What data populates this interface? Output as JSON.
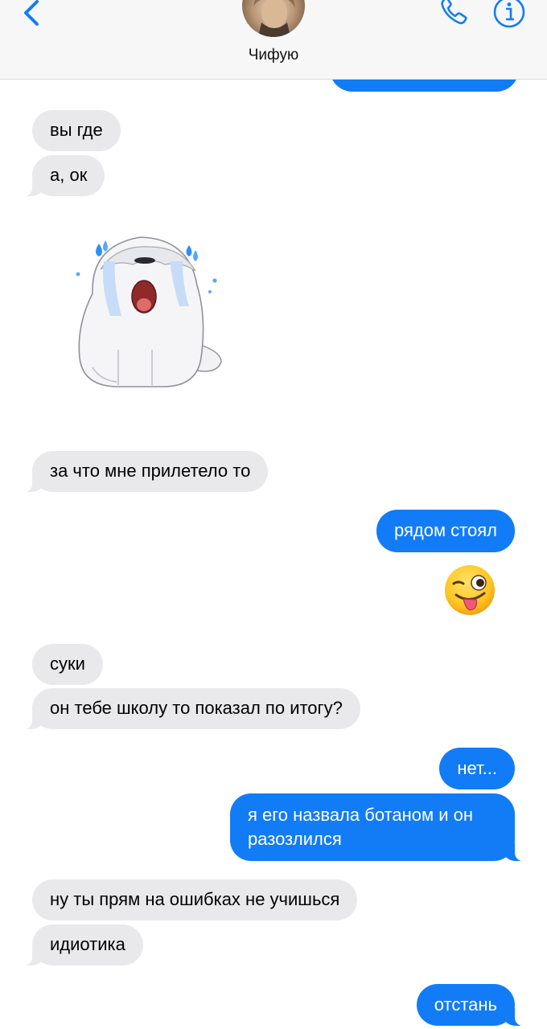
{
  "header": {
    "contact_name": "Чифую",
    "back_icon": "chevron-left-icon",
    "call_icon": "phone-icon",
    "info_icon": "info-icon",
    "accent_color": "#127cf7"
  },
  "messages": [
    {
      "direction": "incoming",
      "text": "вы где"
    },
    {
      "direction": "incoming",
      "text": "а, ок"
    },
    {
      "direction": "incoming",
      "type": "sticker",
      "sticker": "crying-white-dog-sticker"
    },
    {
      "direction": "incoming",
      "text": "за что мне прилетело то"
    },
    {
      "direction": "outgoing",
      "text": "рядом стоял"
    },
    {
      "direction": "outgoing",
      "type": "emoji",
      "emoji": "😜"
    },
    {
      "direction": "incoming",
      "text": "суки"
    },
    {
      "direction": "incoming",
      "text": "он тебе школу то показал по итогу?"
    },
    {
      "direction": "outgoing",
      "text": "нет..."
    },
    {
      "direction": "outgoing",
      "text": "я его назвала ботаном и он разозлился"
    },
    {
      "direction": "incoming",
      "text": "ну ты прям на ошибках не учишься"
    },
    {
      "direction": "incoming",
      "text": "идиотика"
    },
    {
      "direction": "outgoing",
      "text": "отстань"
    }
  ],
  "colors": {
    "incoming_bubble": "#e9e9eb",
    "outgoing_bubble": "#127cf7"
  }
}
